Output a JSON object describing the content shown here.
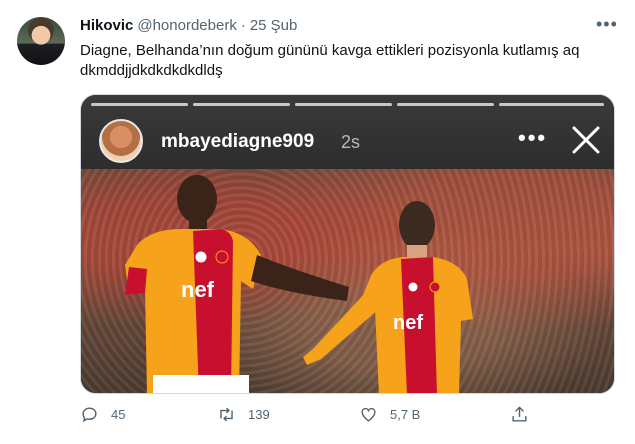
{
  "tweet": {
    "display_name": "Hikovic",
    "handle": "@honordeberk",
    "separator": "·",
    "date": "25 Şub",
    "text": "Diagne, Belhanda’nın doğum gününü kavga ettikleri pozisyonla kutlamış aq dkmddjjdkdkdkdkdldş",
    "more_icon": "more-icon"
  },
  "story": {
    "username": "mbayediagne909",
    "time": "2s",
    "more_label": "•••",
    "close_icon": "close-icon",
    "photo_jersey_text_left": "nef",
    "photo_jersey_text_right": "nef"
  },
  "actions": {
    "reply_count": "45",
    "retweet_count": "139",
    "like_count": "5,7 B",
    "icons": [
      "reply-icon",
      "retweet-icon",
      "like-icon",
      "share-icon"
    ]
  },
  "colors": {
    "secondary_text": "#536471",
    "primary_text": "#0f1419",
    "jersey_red": "#c8102e",
    "jersey_yellow": "#f6a21b"
  }
}
